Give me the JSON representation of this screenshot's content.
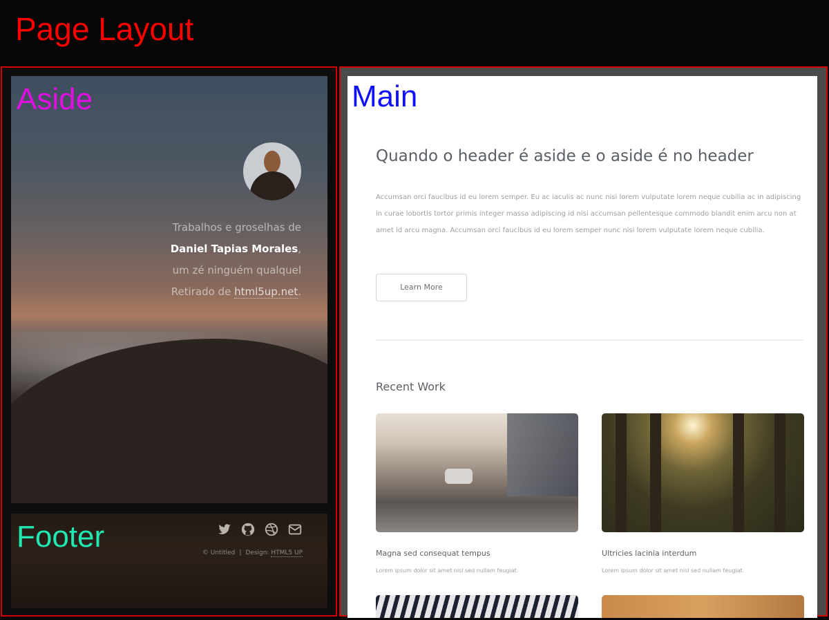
{
  "page": {
    "title": "Page Layout"
  },
  "aside": {
    "label": "Aside",
    "bio": {
      "line1": "Trabalhos e groselhas de",
      "name": "Daniel Tapias Morales",
      "name_suffix": ",",
      "line3": "um zé ninguém qualquel",
      "line4_prefix": "Retirado de",
      "link": "html5up.net",
      "line4_suffix": "."
    }
  },
  "footer": {
    "label": "Footer",
    "icons": [
      "twitter-icon",
      "github-icon",
      "dribbble-icon",
      "envelope-icon"
    ],
    "copyright": "© Untitled",
    "separator": "|",
    "design_label": "Design:",
    "design_link": "HTML5 UP"
  },
  "main": {
    "label": "Main",
    "heading": "Quando o header é aside e o aside é no header",
    "paragraph": "Accumsan orci faucibus id eu lorem semper. Eu ac iaculis ac nunc nisi lorem vulputate lorem neque cubilia ac in adipiscing in curae lobortis tortor primis integer massa adipiscing id nisi accumsan pellentesque commodo blandit enim arcu non at amet id arcu magna. Accumsan orci faucibus id eu lorem semper nunc nisi lorem vulputate lorem neque cubilia.",
    "button_label": "Learn More",
    "recent_work_title": "Recent Work",
    "works": [
      {
        "title": "Magna sed consequat tempus",
        "description": "Lorem ipsum dolor sit amet nisl sed nullam feugiat."
      },
      {
        "title": "Ultricies lacinia interdum",
        "description": "Lorem ipsum dolor sit amet nisl sed nullam feugiat."
      }
    ]
  },
  "colors": {
    "frame_border": "#d40000",
    "page_title": "#ff0000",
    "aside_label": "#e010e0",
    "footer_label": "#20e8b0",
    "main_label": "#1010ff"
  }
}
